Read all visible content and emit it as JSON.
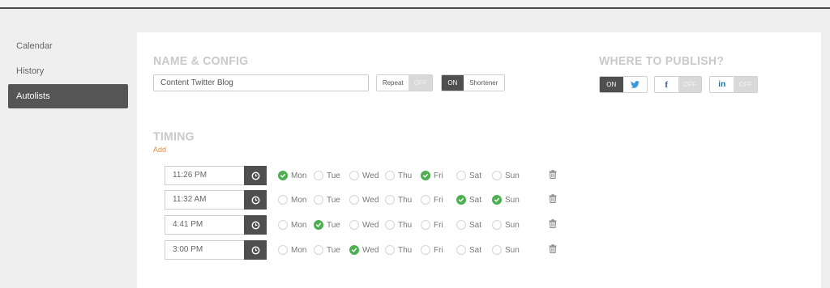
{
  "sidebar": {
    "items": [
      {
        "label": "Calendar",
        "active": false
      },
      {
        "label": "History",
        "active": false
      },
      {
        "label": "Autolists",
        "active": true
      }
    ]
  },
  "config": {
    "title": "NAME & CONFIG",
    "name_value": "Content Twitter Blog",
    "repeat": {
      "label": "Repeat",
      "state": "OFF"
    },
    "shortener": {
      "label": "Shortener",
      "state": "ON"
    }
  },
  "publish": {
    "title": "WHERE TO PUBLISH?",
    "twitter": {
      "state": "ON",
      "icon": "twitter-icon"
    },
    "facebook": {
      "state": "OFF",
      "icon": "facebook-icon"
    },
    "linkedin": {
      "state": "OFF",
      "icon": "linkedin-icon"
    }
  },
  "timing": {
    "title": "TIMING",
    "add_label": "Add",
    "day_labels": [
      "Mon",
      "Tue",
      "Wed",
      "Thu",
      "Fri",
      "Sat",
      "Sun"
    ],
    "rows": [
      {
        "time": "11:26 PM",
        "days": [
          true,
          false,
          false,
          false,
          true,
          false,
          false
        ]
      },
      {
        "time": "11:32 AM",
        "days": [
          false,
          false,
          false,
          false,
          false,
          true,
          true
        ]
      },
      {
        "time": "4:41 PM",
        "days": [
          false,
          true,
          false,
          false,
          false,
          false,
          false
        ]
      },
      {
        "time": "3:00 PM",
        "days": [
          false,
          false,
          true,
          false,
          false,
          false,
          false
        ]
      }
    ]
  },
  "colors": {
    "accent_green": "#4caf50",
    "dark_button": "#4f4f4f",
    "add_link": "#e38b3f",
    "twitter_blue": "#3a9bd8"
  }
}
